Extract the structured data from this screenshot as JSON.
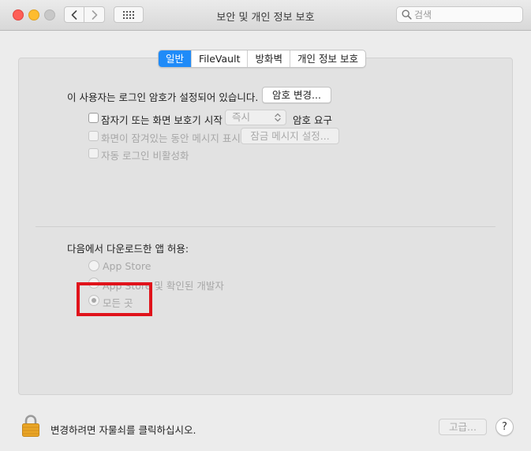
{
  "window": {
    "title": "보안 및 개인 정보 보호"
  },
  "toolbar": {
    "search_placeholder": "검색"
  },
  "tabs": [
    {
      "label": "일반",
      "active": true
    },
    {
      "label": "FileVault",
      "active": false
    },
    {
      "label": "방화벽",
      "active": false
    },
    {
      "label": "개인 정보 보호",
      "active": false
    }
  ],
  "general": {
    "password_status": "이 사용자는 로그인 암호가 설정되어 있습니다.",
    "change_password_label": "암호 변경...",
    "require_password_checkbox": {
      "label": "잠자기 또는 화면 보호기 시작",
      "checked": false
    },
    "require_password_delay": "즉시",
    "require_password_suffix": "암호 요구",
    "lock_message_checkbox": {
      "label": "화면이 잠겨있는 동안 메시지 표시",
      "checked": false,
      "enabled": false
    },
    "set_lock_message_label": "잠금 메시지 설정...",
    "disable_auto_login_checkbox": {
      "label": "자동 로그인 비활성화",
      "checked": false,
      "enabled": false
    }
  },
  "downloads": {
    "heading": "다음에서 다운로드한 앱 허용:",
    "options": [
      {
        "label": "App Store",
        "selected": false
      },
      {
        "label": "App Store 및 확인된 개발자",
        "selected": false
      },
      {
        "label": "모든 곳",
        "selected": true
      }
    ]
  },
  "footer": {
    "lock_message": "변경하려면 자물쇠를 클릭하십시오.",
    "advanced_label": "고급...",
    "help_label": "?"
  },
  "colors": {
    "accent": "#1f8bf8",
    "highlight": "#e0131b"
  },
  "icons": [
    "close-icon",
    "minimize-icon",
    "zoom-icon",
    "chevron-left-icon",
    "chevron-right-icon",
    "grid-icon",
    "search-icon",
    "lock-icon",
    "help-icon"
  ]
}
